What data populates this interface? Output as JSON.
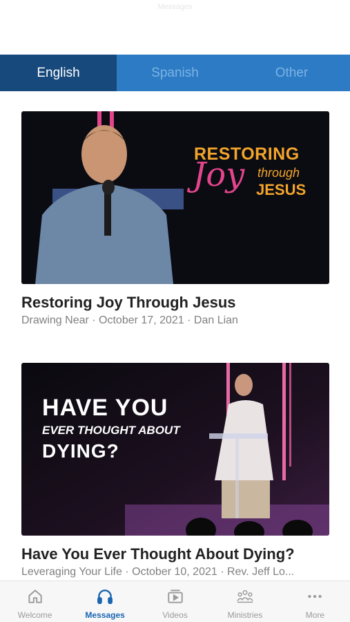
{
  "status_hint": "Messages",
  "tabs": [
    {
      "label": "English",
      "active": true
    },
    {
      "label": "Spanish",
      "active": false
    },
    {
      "label": "Other",
      "active": false
    }
  ],
  "cards": [
    {
      "title": "Restoring Joy Through Jesus",
      "meta": "Drawing Near · October 17, 2021 · Dan Lian",
      "thumb_text": {
        "line1": "RESTORING",
        "line2": "Joy",
        "line3": "through",
        "line4": "JESUS"
      }
    },
    {
      "title": "Have You Ever Thought About Dying?",
      "meta": "Leveraging Your Life · October 10, 2021 · Rev. Jeff Lo...",
      "thumb_text": {
        "line1": "HAVE YOU",
        "line2": "EVER THOUGHT ABOUT",
        "line3": "DYING?"
      }
    }
  ],
  "bottom_nav": [
    {
      "label": "Welcome",
      "icon": "home-icon",
      "active": false
    },
    {
      "label": "Messages",
      "icon": "headphones-icon",
      "active": true
    },
    {
      "label": "Videos",
      "icon": "video-icon",
      "active": false
    },
    {
      "label": "Ministries",
      "icon": "people-icon",
      "active": false
    },
    {
      "label": "More",
      "icon": "more-icon",
      "active": false
    }
  ],
  "colors": {
    "tab_bar": "#2c7bc4",
    "tab_active": "#17497c",
    "nav_active": "#1a65b3"
  }
}
